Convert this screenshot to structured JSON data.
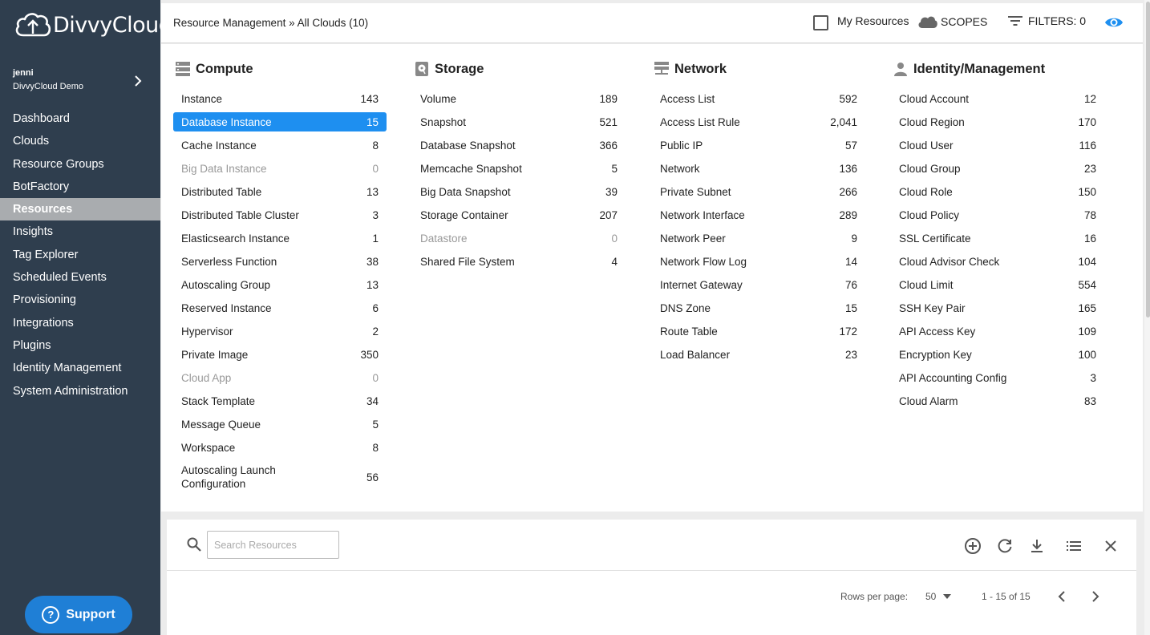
{
  "app": {
    "logo_text": "DivvyCloud",
    "user_name": "jenni",
    "user_org": "DivvyCloud Demo",
    "support_label": "Support"
  },
  "nav": [
    {
      "label": "Dashboard",
      "active": false
    },
    {
      "label": "Clouds",
      "active": false
    },
    {
      "label": "Resource Groups",
      "active": false
    },
    {
      "label": "BotFactory",
      "active": false
    },
    {
      "label": "Resources",
      "active": true
    },
    {
      "label": "Insights",
      "active": false
    },
    {
      "label": "Tag Explorer",
      "active": false
    },
    {
      "label": "Scheduled Events",
      "active": false
    },
    {
      "label": "Provisioning",
      "active": false
    },
    {
      "label": "Integrations",
      "active": false
    },
    {
      "label": "Plugins",
      "active": false
    },
    {
      "label": "Identity Management",
      "active": false
    },
    {
      "label": "System Administration",
      "active": false
    }
  ],
  "topbar": {
    "breadcrumb": "Resource Management » All Clouds (10)",
    "my_resources_label": "My Resources",
    "my_resources_checked": false,
    "scopes_label": "SCOPES",
    "filters_label": "FILTERS: 0"
  },
  "colors": {
    "sidebar_bg": "#2f3e4e",
    "accent": "#1e8ff0",
    "support_bg": "#1f7fd6",
    "active_nav_bg": "#a9acaf"
  },
  "columns": [
    {
      "title": "Compute",
      "icon": "server-icon",
      "items": [
        {
          "label": "Instance",
          "count": "143"
        },
        {
          "label": "Database Instance",
          "count": "15",
          "selected": true
        },
        {
          "label": "Cache Instance",
          "count": "8"
        },
        {
          "label": "Big Data Instance",
          "count": "0",
          "dim": true
        },
        {
          "label": "Distributed Table",
          "count": "13"
        },
        {
          "label": "Distributed Table Cluster",
          "count": "3"
        },
        {
          "label": "Elasticsearch Instance",
          "count": "1"
        },
        {
          "label": "Serverless Function",
          "count": "38"
        },
        {
          "label": "Autoscaling Group",
          "count": "13"
        },
        {
          "label": "Reserved Instance",
          "count": "6"
        },
        {
          "label": "Hypervisor",
          "count": "2"
        },
        {
          "label": "Private Image",
          "count": "350"
        },
        {
          "label": "Cloud App",
          "count": "0",
          "dim": true
        },
        {
          "label": "Stack Template",
          "count": "34"
        },
        {
          "label": "Message Queue",
          "count": "5"
        },
        {
          "label": "Workspace",
          "count": "8"
        },
        {
          "label": "Autoscaling Launch Configuration",
          "count": "56"
        }
      ]
    },
    {
      "title": "Storage",
      "icon": "disk-icon",
      "items": [
        {
          "label": "Volume",
          "count": "189"
        },
        {
          "label": "Snapshot",
          "count": "521"
        },
        {
          "label": "Database Snapshot",
          "count": "366"
        },
        {
          "label": "Memcache Snapshot",
          "count": "5"
        },
        {
          "label": "Big Data Snapshot",
          "count": "39"
        },
        {
          "label": "Storage Container",
          "count": "207"
        },
        {
          "label": "Datastore",
          "count": "0",
          "dim": true
        },
        {
          "label": "Shared File System",
          "count": "4"
        }
      ]
    },
    {
      "title": "Network",
      "icon": "network-icon",
      "items": [
        {
          "label": "Access List",
          "count": "592"
        },
        {
          "label": "Access List Rule",
          "count": "2,041"
        },
        {
          "label": "Public IP",
          "count": "57"
        },
        {
          "label": "Network",
          "count": "136"
        },
        {
          "label": "Private Subnet",
          "count": "266"
        },
        {
          "label": "Network Interface",
          "count": "289"
        },
        {
          "label": "Network Peer",
          "count": "9"
        },
        {
          "label": "Network Flow Log",
          "count": "14"
        },
        {
          "label": "Internet Gateway",
          "count": "76"
        },
        {
          "label": "DNS Zone",
          "count": "15"
        },
        {
          "label": "Route Table",
          "count": "172"
        },
        {
          "label": "Load Balancer",
          "count": "23"
        }
      ]
    },
    {
      "title": "Identity/Management",
      "icon": "person-icon",
      "items": [
        {
          "label": "Cloud Account",
          "count": "12"
        },
        {
          "label": "Cloud Region",
          "count": "170"
        },
        {
          "label": "Cloud User",
          "count": "116"
        },
        {
          "label": "Cloud Group",
          "count": "23"
        },
        {
          "label": "Cloud Role",
          "count": "150"
        },
        {
          "label": "Cloud Policy",
          "count": "78"
        },
        {
          "label": "SSL Certificate",
          "count": "16"
        },
        {
          "label": "Cloud Advisor Check",
          "count": "104"
        },
        {
          "label": "Cloud Limit",
          "count": "554"
        },
        {
          "label": "SSH Key Pair",
          "count": "165"
        },
        {
          "label": "API Access Key",
          "count": "109"
        },
        {
          "label": "Encryption Key",
          "count": "100"
        },
        {
          "label": "API Accounting Config",
          "count": "3"
        },
        {
          "label": "Cloud Alarm",
          "count": "83"
        }
      ]
    }
  ],
  "results": {
    "search_placeholder": "Search Resources",
    "search_value": "",
    "rows_per_page_label": "Rows per page:",
    "rows_per_page_value": "50",
    "range_text": "1 - 15 of 15"
  }
}
